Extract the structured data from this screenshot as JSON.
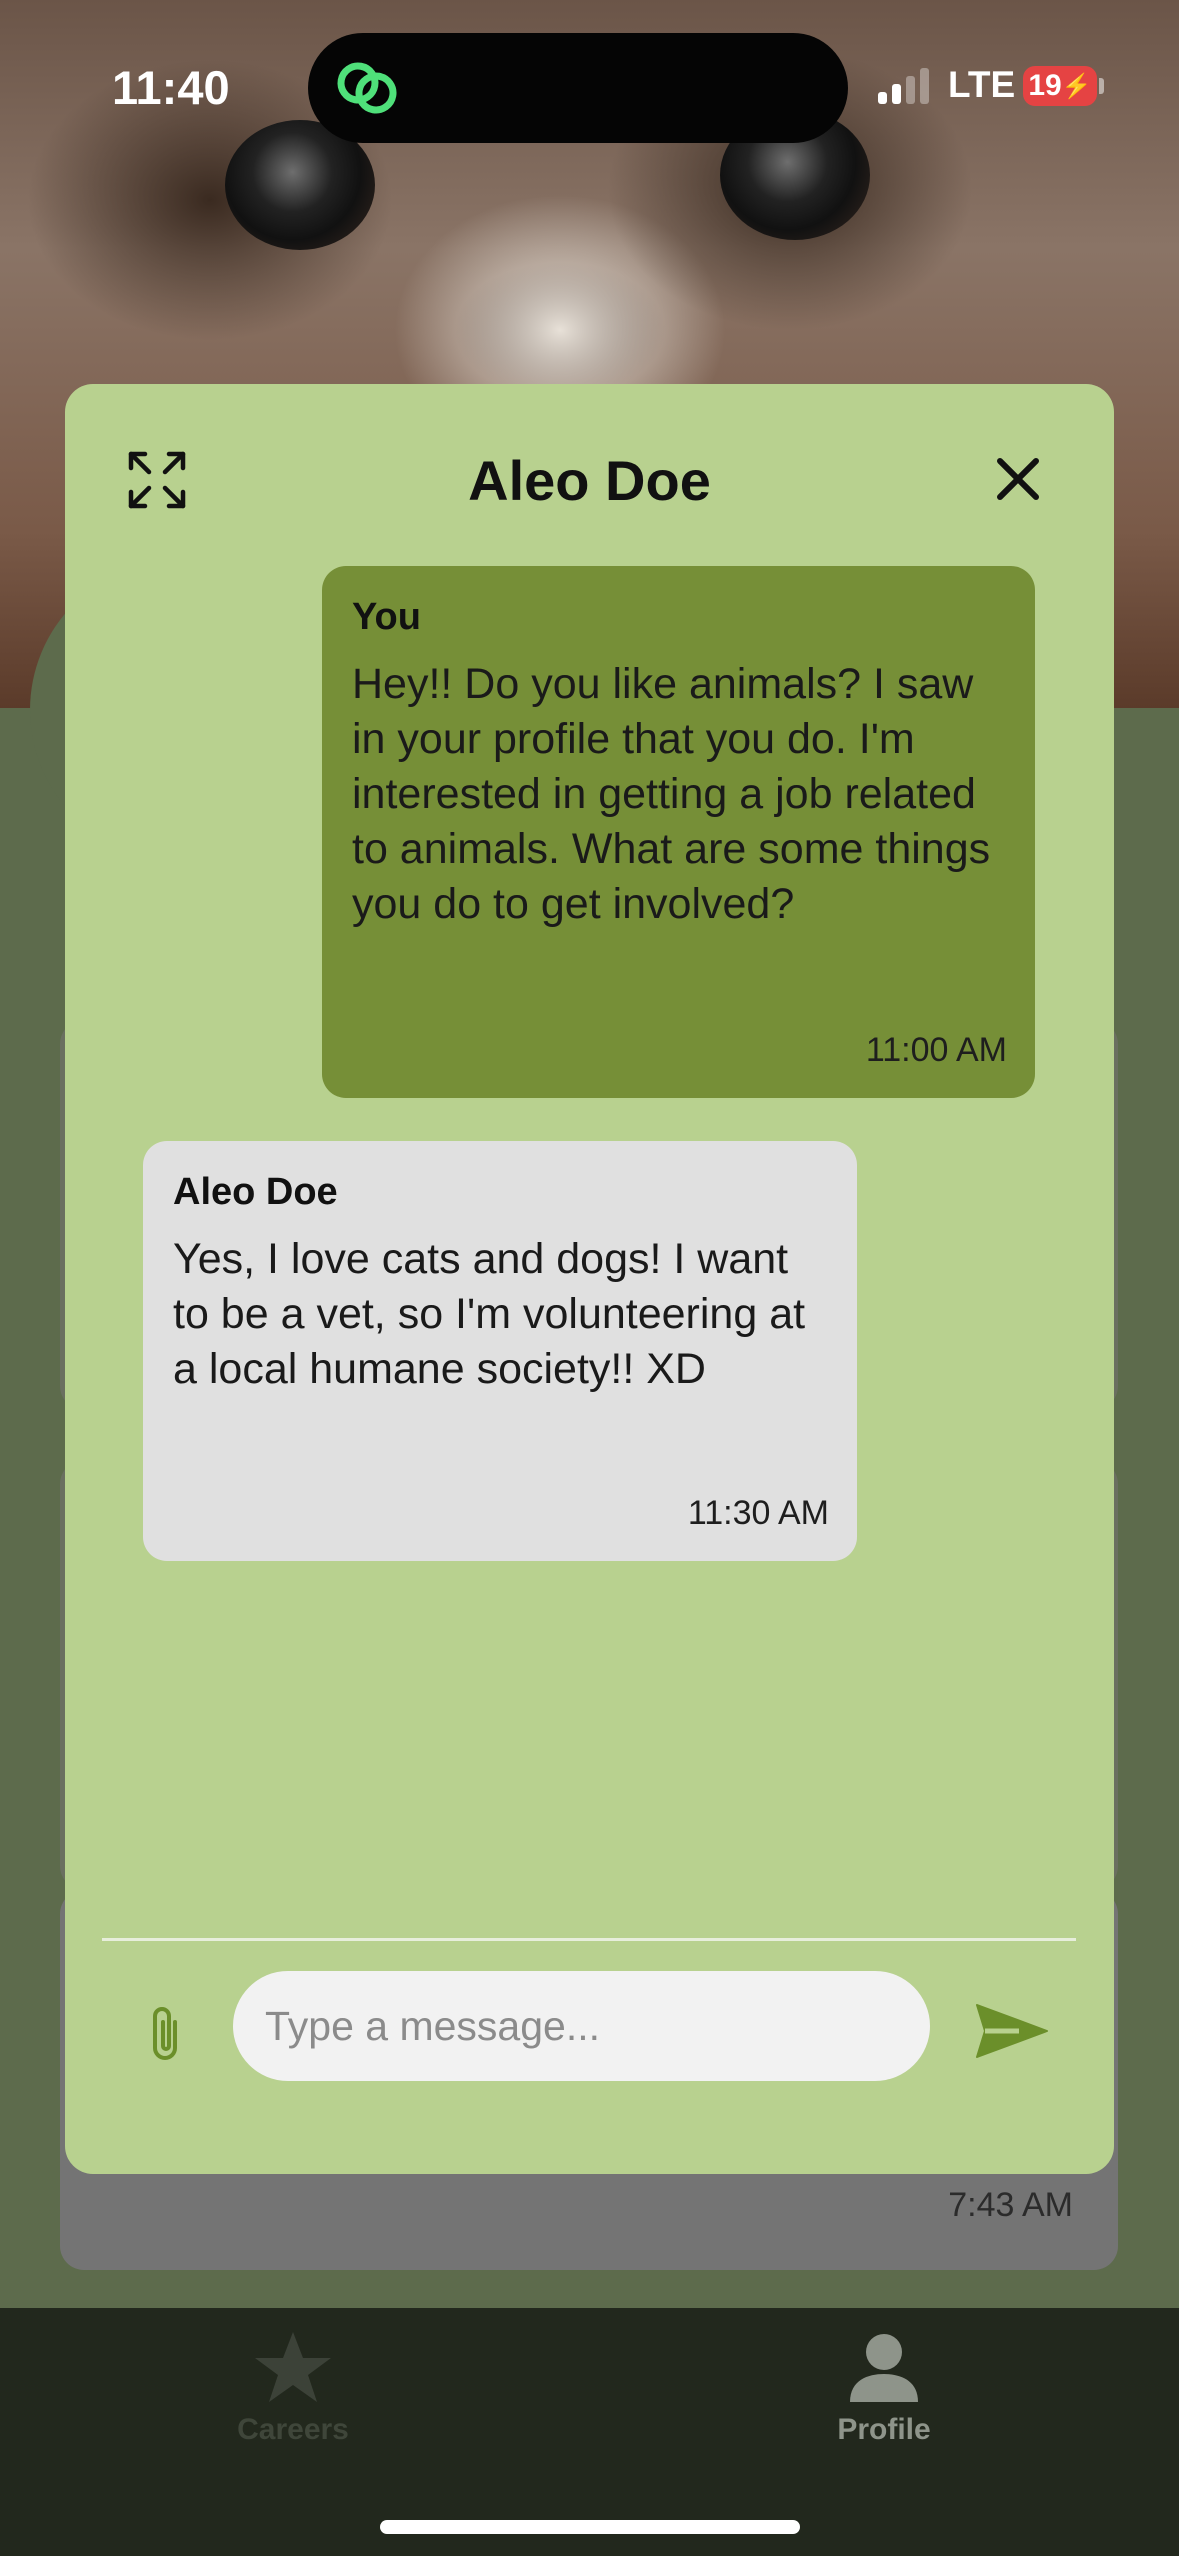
{
  "status_bar": {
    "time": "11:40",
    "network": "LTE",
    "battery": "19"
  },
  "background": {
    "last_message_time": "7:43 AM"
  },
  "chat": {
    "title": "Aleo Doe",
    "messages": [
      {
        "sender": "You",
        "text": "Hey!! Do you like animals? I saw in your profile that you do. I'm interested in getting a job related to animals. What are some things you do to get involved?",
        "time": "11:00 AM",
        "bubble_color": "#768f37"
      },
      {
        "sender": "Aleo Doe",
        "text": "Yes, I love cats and dogs! I want to be a vet, so I'm volunteering at a local humane society!! XD",
        "time": "11:30 AM",
        "bubble_color": "#e0e0e0"
      }
    ],
    "input": {
      "placeholder": "Type a message...",
      "value": ""
    },
    "accent_color": "#6b8f2a",
    "modal_color": "#b8d18f"
  },
  "tabbar": {
    "items": [
      {
        "label": "Careers",
        "icon": "star-icon",
        "active": false
      },
      {
        "label": "Profile",
        "icon": "person-icon",
        "active": true
      }
    ]
  }
}
